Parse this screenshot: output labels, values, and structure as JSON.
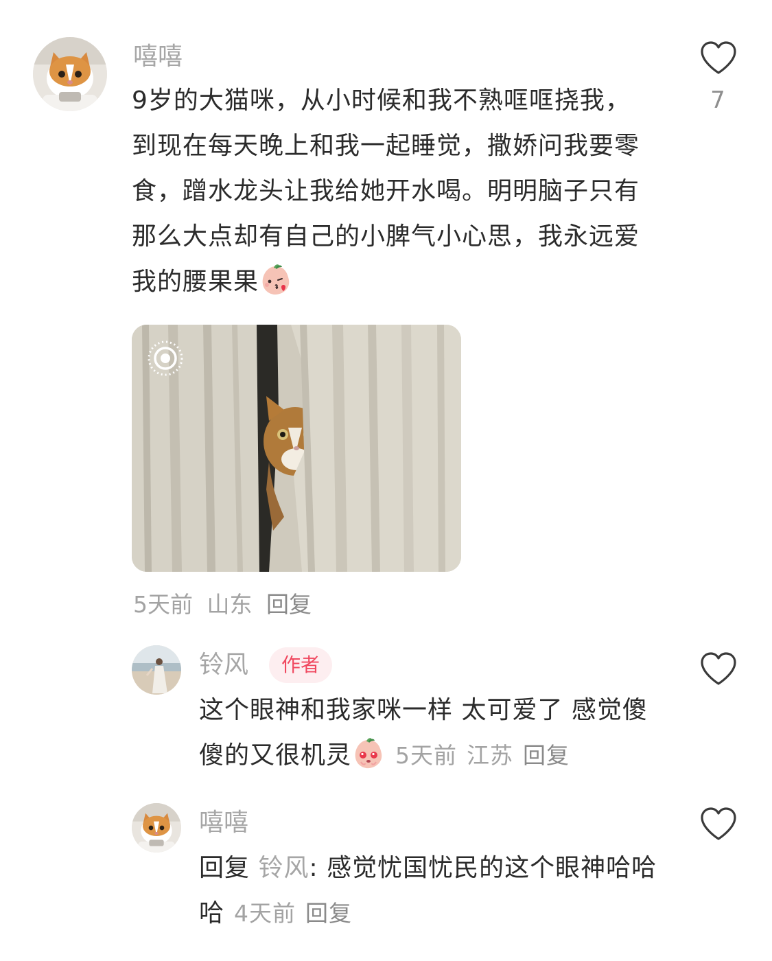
{
  "comment": {
    "author": "嘻嘻",
    "text": "9岁的大猫咪，从小时候和我不熟哐哐挠我，到现在每天晚上和我一起睡觉，撒娇问我要零食，蹭水龙头让我给她开水喝。明明脑子只有那么大点却有自己的小脾气小心思，我永远爱我的腰果果",
    "like_count": "7",
    "emoji": "kiss-peach-emoji",
    "live_photo_icon": "live-photo-icon",
    "time": "5天前",
    "location": "山东",
    "reply_label": "回复"
  },
  "replies": [
    {
      "author": "铃风",
      "badge": "作者",
      "text": "这个眼神和我家咪一样 太可爱了 感觉傻傻的又很机灵",
      "emoji": "teary-peach-emoji",
      "time": "5天前",
      "location": "江苏",
      "reply_label": "回复"
    },
    {
      "author": "嘻嘻",
      "reply_prefix": "回复",
      "reply_to": "铃风",
      "colon": ":",
      "text": "感觉忧国忧民的这个眼神哈哈哈",
      "time": "4天前",
      "reply_label": "回复"
    }
  ],
  "colors": {
    "author_badge_bg": "#fdeef0",
    "author_badge_text": "#f0485f",
    "meta_gray": "#a3a3a3"
  }
}
